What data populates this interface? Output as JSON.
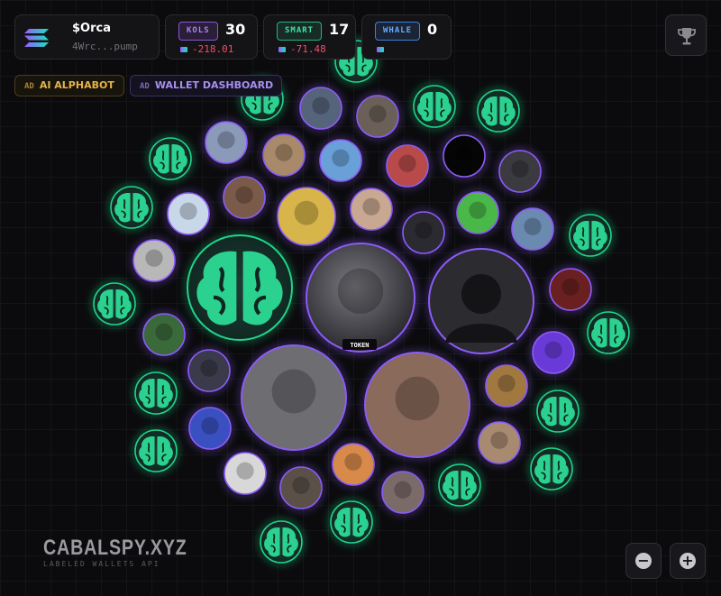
{
  "token": {
    "symbol": "$Orca",
    "address": "4Wrc...pump",
    "center_label": "TOKEN"
  },
  "stats": [
    {
      "id": "kols",
      "label": "KOLS",
      "count": "30",
      "value": "-218.01"
    },
    {
      "id": "smart",
      "label": "SMART",
      "count": "17",
      "value": "-71.48"
    },
    {
      "id": "whale",
      "label": "WHALE",
      "count": "0",
      "value": ""
    }
  ],
  "ads": [
    {
      "tag": "AD",
      "label": "AI ALPHABOT"
    },
    {
      "tag": "AD",
      "label": "WALLET DASHBOARD"
    }
  ],
  "brand": {
    "title": "CABALSPY.XYZ",
    "subtitle": "LABELED WALLETS API"
  },
  "icons": {
    "trophy": "trophy-icon",
    "zoom_out": "minus-icon",
    "zoom_in": "plus-icon",
    "smart_wallet": "brain-icon"
  },
  "colors": {
    "smart_green": "#1fd38a",
    "kol_purple": "#8b5cf6",
    "negative_red": "#ef4e66",
    "ad_gold": "#e6b34c",
    "ad_purple": "#a98ef0"
  }
}
